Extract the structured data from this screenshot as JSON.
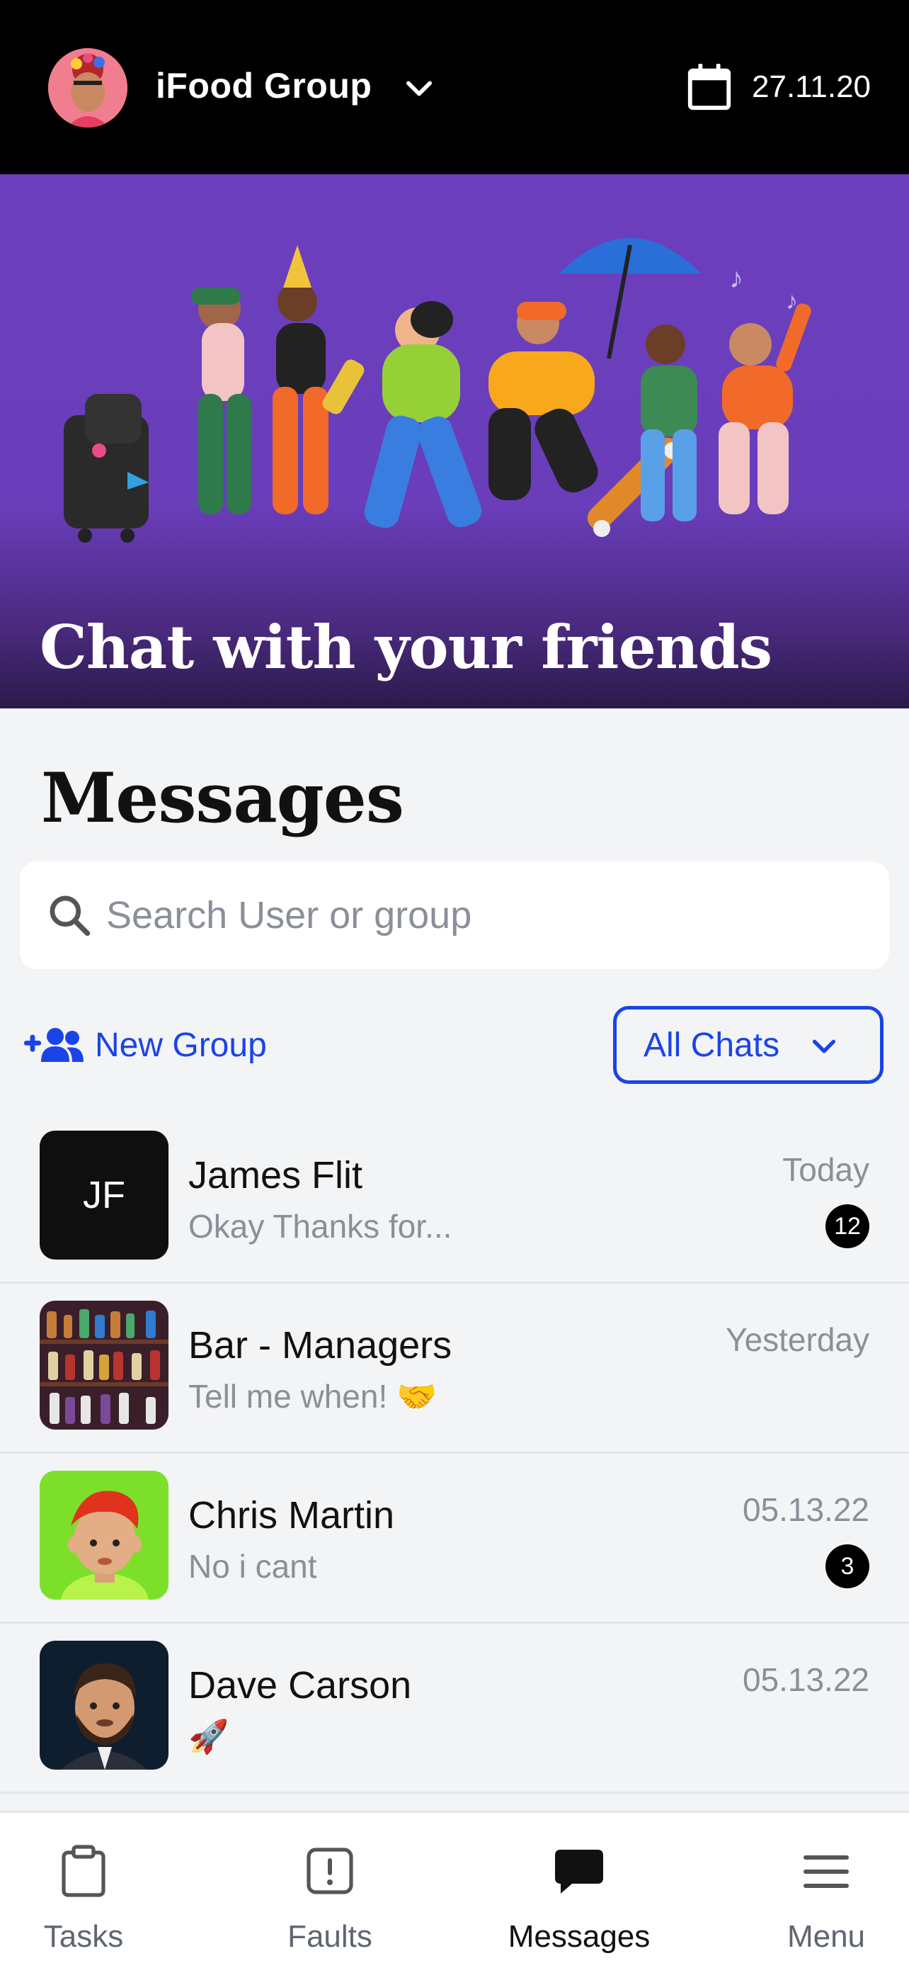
{
  "header": {
    "org_name": "iFood Group",
    "date": "27.11.20"
  },
  "hero": {
    "title": "Chat with your friends"
  },
  "messages": {
    "title": "Messages",
    "search_placeholder": "Search User or group",
    "new_group_label": "New Group",
    "filter_label": "All Chats"
  },
  "chats": [
    {
      "name": "James Flit",
      "preview": "Okay Thanks for...",
      "time": "Today",
      "badge": "12",
      "initials": "JF"
    },
    {
      "name": "Bar - Managers",
      "preview": "Tell me when! 🤝",
      "time": "Yesterday"
    },
    {
      "name": "Chris Martin",
      "preview": "No i cant",
      "time": "05.13.22",
      "badge": "3"
    },
    {
      "name": "Dave Carson",
      "preview": "🚀",
      "time": "05.13.22"
    }
  ],
  "tabs": [
    {
      "label": "Tasks",
      "icon": "clipboard-icon"
    },
    {
      "label": "Faults",
      "icon": "alert-square-icon"
    },
    {
      "label": "Messages",
      "icon": "chat-bubble-icon",
      "active": true
    },
    {
      "label": "Menu",
      "icon": "hamburger-menu-icon"
    }
  ],
  "colors": {
    "accent": "#1b44e6",
    "hero_bg": "#6c3fbd",
    "header_bg": "#000000"
  }
}
